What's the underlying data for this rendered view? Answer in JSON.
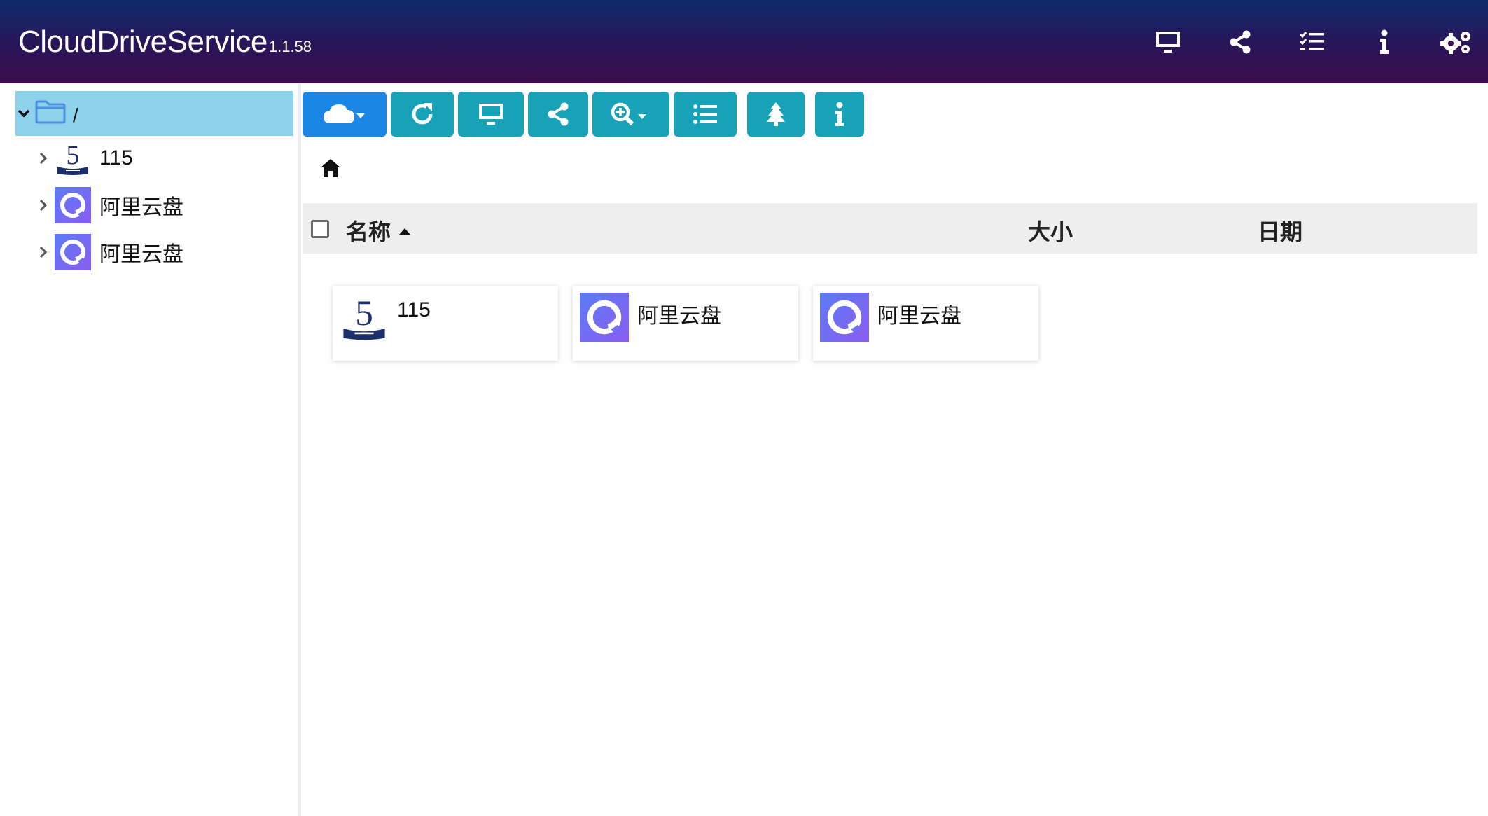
{
  "header": {
    "title": "CloudDriveService",
    "version": "1.1.58",
    "icons": [
      "monitor-icon",
      "share-icon",
      "task-list-icon",
      "info-icon",
      "settings-gears-icon"
    ]
  },
  "colors": {
    "header_top": "#0e2a6a",
    "header_bottom": "#3c0c4a",
    "toolbar_teal": "#17a2b8",
    "toolbar_primary": "#1b86e4",
    "tree_selected": "#8ed1ea"
  },
  "sidebar": {
    "root_label": "/",
    "items": [
      {
        "label": "115",
        "icon": "115-logo-icon"
      },
      {
        "label": "阿里云盘",
        "icon": "aliyun-drive-logo-icon"
      },
      {
        "label": "阿里云盘",
        "icon": "aliyun-drive-logo-icon"
      }
    ]
  },
  "toolbar": {
    "buttons": [
      "cloud-dropdown-icon",
      "refresh-icon",
      "monitor-icon",
      "share-icon",
      "search-plus-dropdown-icon",
      "list-icon",
      "tree-icon",
      "info-icon"
    ]
  },
  "list": {
    "columns": {
      "name": "名称",
      "size": "大小",
      "date": "日期"
    }
  },
  "files": [
    {
      "label": "115",
      "icon": "115-logo-icon"
    },
    {
      "label": "阿里云盘",
      "icon": "aliyun-drive-logo-icon"
    },
    {
      "label": "阿里云盘",
      "icon": "aliyun-drive-logo-icon"
    }
  ]
}
